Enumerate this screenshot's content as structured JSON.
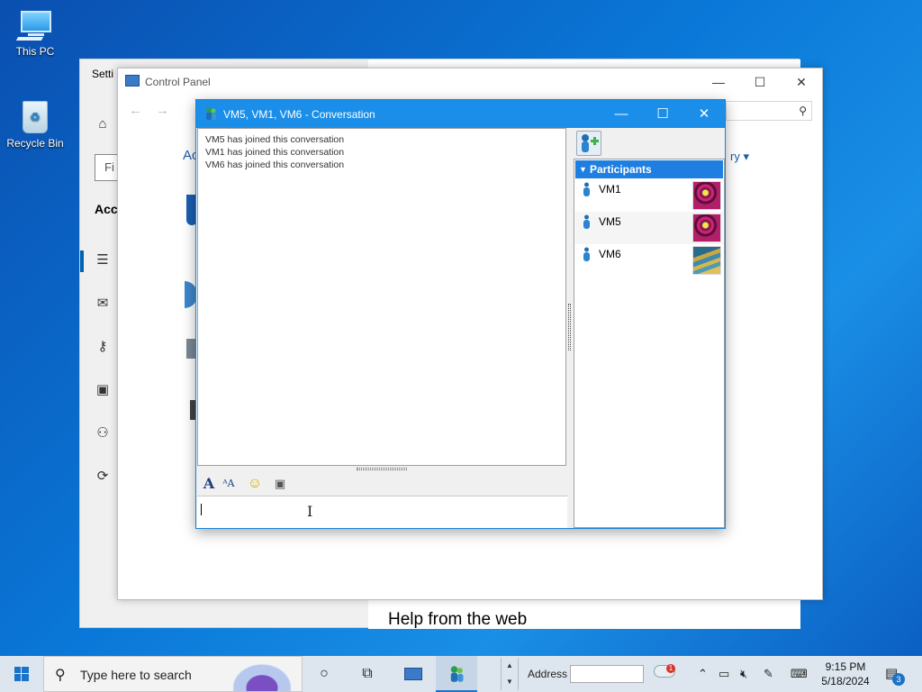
{
  "desktop": {
    "icons": [
      {
        "label": "This PC"
      },
      {
        "label": "Recycle Bin"
      }
    ]
  },
  "settings_window": {
    "title": "Setti",
    "find_placeholder": "Fi",
    "section_heading": "Acc",
    "help_heading": "Help from the web"
  },
  "control_panel": {
    "title": "Control Panel",
    "partial_link_left": "Ac",
    "partial_link_right": "ry ▾"
  },
  "conversation": {
    "title": "VM5, VM1, VM6 - Conversation",
    "messages": [
      "VM5 has joined this conversation",
      "VM1 has joined this conversation",
      "VM6 has joined this conversation"
    ],
    "participants_header": "Participants",
    "participants": [
      {
        "name": "VM1",
        "avatar": "ball"
      },
      {
        "name": "VM5",
        "avatar": "ball"
      },
      {
        "name": "VM6",
        "avatar": "stairs"
      }
    ],
    "input_value": ""
  },
  "taskbar": {
    "search_placeholder": "Type here to search",
    "address_label": "Address",
    "address_value": "",
    "weather_badge": "1",
    "time": "9:15 PM",
    "date": "5/18/2024",
    "notification_count": "3"
  },
  "colors": {
    "titlebar_active": "#1a8ee8",
    "participants_header": "#1f7fe0",
    "desktop": "#0a78d8",
    "taskbar": "#dde6ef"
  }
}
